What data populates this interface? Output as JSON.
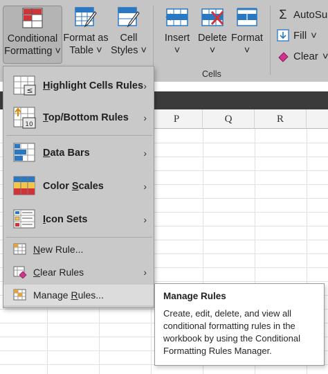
{
  "ribbon": {
    "conditional_formatting": {
      "line1": "Conditional",
      "line2": "Formatting"
    },
    "format_as_table": {
      "line1": "Format as",
      "line2": "Table"
    },
    "cell_styles": {
      "line1": "Cell",
      "line2": "Styles"
    },
    "insert": "Insert",
    "delete": "Delete",
    "format": "Format",
    "cells_group": "Cells",
    "autosum": "AutoSu",
    "fill": "Fill",
    "clear": "Clear",
    "dropdown_caret": "˅"
  },
  "grid": {
    "columns": [
      "P",
      "Q",
      "R"
    ]
  },
  "menu": {
    "highlight": {
      "u": "H",
      "rest": "ighlight Cells Rules"
    },
    "topbottom": {
      "u": "T",
      "rest": "op/Bottom Rules"
    },
    "databars": {
      "u": "D",
      "rest": "ata Bars"
    },
    "colorscales": {
      "pre": "Color ",
      "u": "S",
      "rest": "cales"
    },
    "iconsets": {
      "u": "I",
      "rest": "con Sets"
    },
    "newrule": {
      "u": "N",
      "rest": "ew Rule..."
    },
    "clearrules": {
      "u": "C",
      "rest": "lear Rules"
    },
    "managerules": {
      "pre": "Manage ",
      "u": "R",
      "rest": "ules..."
    },
    "chevron": "›"
  },
  "tooltip": {
    "title": "Manage Rules",
    "body": "Create, edit, delete, and view all conditional formatting rules in the workbook by using the Conditional Formatting Rules Manager."
  },
  "colors": {
    "ribbon_bg": "#c5c5c5",
    "menu_bg": "#c9c9c9",
    "accent_blue": "#2b78c2",
    "accent_red": "#d13438"
  }
}
